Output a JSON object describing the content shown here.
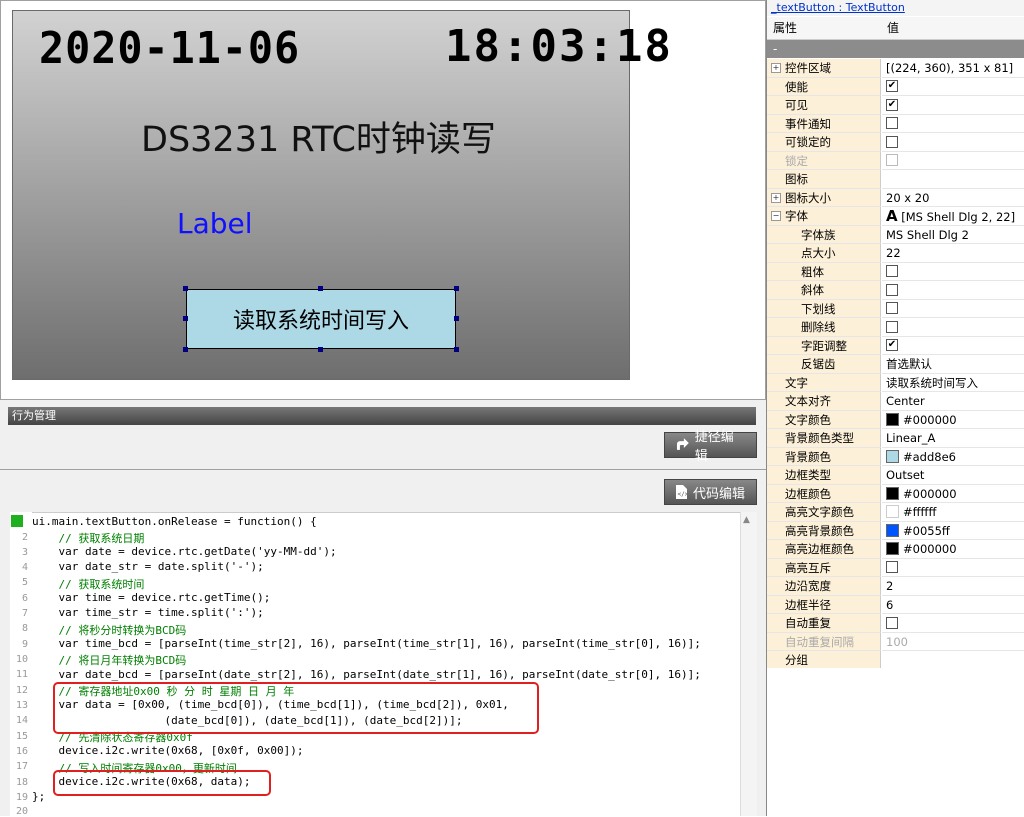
{
  "preview": {
    "date": "2020-11-06",
    "time": "18:03:18",
    "title": "DS3231 RTC时钟读写",
    "label": "Label",
    "button": "读取系统时间写入"
  },
  "behavior": {
    "title": "行为管理",
    "shortcut_edit": "捷径编辑",
    "code_edit": "代码编辑"
  },
  "code": {
    "l1": "ui.main.textButton.onRelease = function() {",
    "l2": "    // 获取系统日期",
    "l3": "    var date = device.rtc.getDate('yy-MM-dd');",
    "l4": "    var date_str = date.split('-');",
    "l5": "    // 获取系统时间",
    "l6": "    var time = device.rtc.getTime();",
    "l7": "    var time_str = time.split(':');",
    "l8": "    // 将秒分时转换为BCD码",
    "l9": "    var time_bcd = [parseInt(time_str[2], 16), parseInt(time_str[1], 16), parseInt(time_str[0], 16)];",
    "l10": "    // 将日月年转换为BCD码",
    "l11": "    var date_bcd = [parseInt(date_str[2], 16), parseInt(date_str[1], 16), parseInt(date_str[0], 16)];",
    "l12": "    // 寄存器地址0x00 秒 分 时 星期 日 月 年",
    "l13": "    var data = [0x00, (time_bcd[0]), (time_bcd[1]), (time_bcd[2]), 0x01,",
    "l14": "                    (date_bcd[0]), (date_bcd[1]), (date_bcd[2])];",
    "l15": "    // 先清除状态寄存器0x0f",
    "l16": "    device.i2c.write(0x68, [0x0f, 0x00]);",
    "l17": "    // 写入时间寄存器0x00，更新时间",
    "l18": "    device.i2c.write(0x68, data);",
    "l19": "};",
    "l20": ""
  },
  "props": {
    "header": "_textButton : TextButton",
    "col_name": "属性",
    "col_value": "值",
    "group": "-",
    "rows": {
      "r1": {
        "name": "控件区域",
        "value": "[(224, 360), 351 x 81]"
      },
      "r2": {
        "name": "使能"
      },
      "r3": {
        "name": "可见"
      },
      "r4": {
        "name": "事件通知"
      },
      "r5": {
        "name": "可锁定的"
      },
      "r6": {
        "name": "锁定"
      },
      "r7": {
        "name": "图标",
        "value": ""
      },
      "r8": {
        "name": "图标大小",
        "value": "20 x 20"
      },
      "r9": {
        "name": "字体",
        "value": "[MS Shell Dlg 2, 22]",
        "glyph": "A"
      },
      "r10": {
        "name": "字体族",
        "value": "MS Shell Dlg 2"
      },
      "r11": {
        "name": "点大小",
        "value": "22"
      },
      "r12": {
        "name": "粗体"
      },
      "r13": {
        "name": "斜体"
      },
      "r14": {
        "name": "下划线"
      },
      "r15": {
        "name": "删除线"
      },
      "r16": {
        "name": "字距调整"
      },
      "r17": {
        "name": "反锯齿",
        "value": "首选默认"
      },
      "r18": {
        "name": "文字",
        "value": "读取系统时间写入"
      },
      "r19": {
        "name": "文本对齐",
        "value": "Center"
      },
      "r20": {
        "name": "文字颜色",
        "value": "#000000",
        "color": "#000000"
      },
      "r21": {
        "name": "背景颜色类型",
        "value": "Linear_A"
      },
      "r22": {
        "name": "背景颜色",
        "value": "#add8e6",
        "color": "#add8e6"
      },
      "r23": {
        "name": "边框类型",
        "value": "Outset"
      },
      "r24": {
        "name": "边框颜色",
        "value": "#000000",
        "color": "#000000"
      },
      "r25": {
        "name": "高亮文字颜色",
        "value": "#ffffff",
        "color": "#ffffff"
      },
      "r26": {
        "name": "高亮背景颜色",
        "value": "#0055ff",
        "color": "#0055ff"
      },
      "r27": {
        "name": "高亮边框颜色",
        "value": "#000000",
        "color": "#000000"
      },
      "r28": {
        "name": "高亮互斥"
      },
      "r29": {
        "name": "边沿宽度",
        "value": "2"
      },
      "r30": {
        "name": "边框半径",
        "value": "6"
      },
      "r31": {
        "name": "自动重复"
      },
      "r32": {
        "name": "自动重复间隔",
        "value": "100"
      },
      "r33": {
        "name": "分组",
        "value": ""
      }
    },
    "checks": {
      "r2": true,
      "r3": true,
      "r4": false,
      "r5": false,
      "r6": false,
      "r12": false,
      "r13": false,
      "r14": false,
      "r15": false,
      "r16": true,
      "r28": false,
      "r31": false
    }
  },
  "icons": {
    "check": "✔",
    "expand": "+"
  }
}
